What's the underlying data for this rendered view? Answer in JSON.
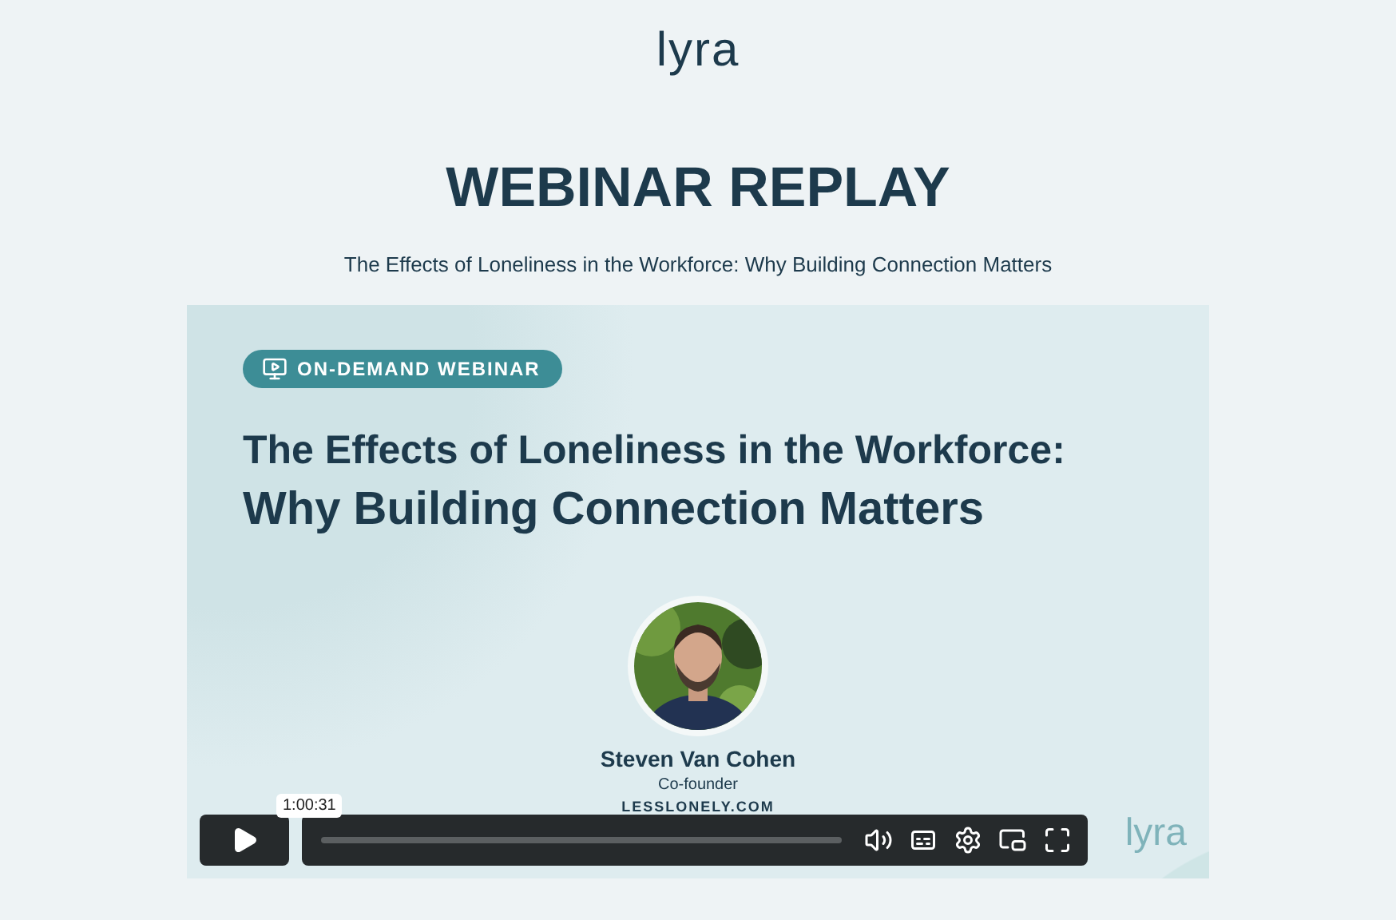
{
  "logo": "lyra",
  "heading": "WEBINAR REPLAY",
  "subtitle": "The Effects of Loneliness in the Workforce: Why Building Connection Matters",
  "video": {
    "badge": "ON-DEMAND WEBINAR",
    "title_lines": [
      "The Effects of Loneliness in the Workforce:",
      "Why Building Connection Matters"
    ],
    "speaker": {
      "name": "Steven Van Cohen",
      "role": "Co-founder",
      "site": "LESSLONELY.COM"
    },
    "watermark": "lyra",
    "player": {
      "time_tooltip": "1:00:31"
    }
  }
}
